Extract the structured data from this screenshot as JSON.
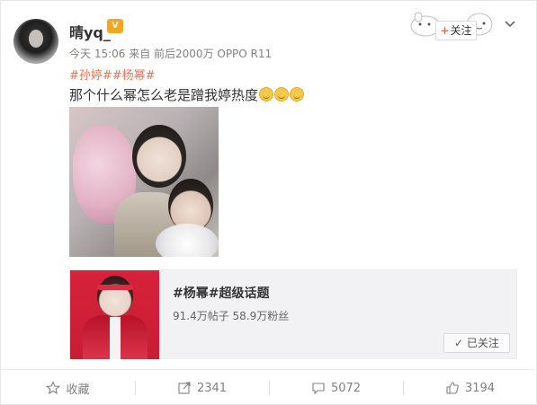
{
  "post": {
    "username": "晴yq_",
    "vip_badge": "vip",
    "meta": "今天 15:06 来自 前后2000万 OPPO R11",
    "hashtags": "#孙婷##杨幂#",
    "text": "那个什么幂怎么老是蹭我婷热度",
    "emoji_count": 3,
    "follow_label": "关注"
  },
  "topic_card": {
    "title": "#杨幂#超级话题",
    "stats": "91.4万帖子 58.9万粉丝",
    "followed_label": "已关注"
  },
  "actions": [
    {
      "icon": "star-icon",
      "label": "收藏"
    },
    {
      "icon": "share-icon",
      "label": "2341"
    },
    {
      "icon": "comment-icon",
      "label": "5072"
    },
    {
      "icon": "like-icon",
      "label": "3194"
    }
  ],
  "colors": {
    "accent": "#eb7350",
    "text": "#333333",
    "muted": "#808080"
  }
}
